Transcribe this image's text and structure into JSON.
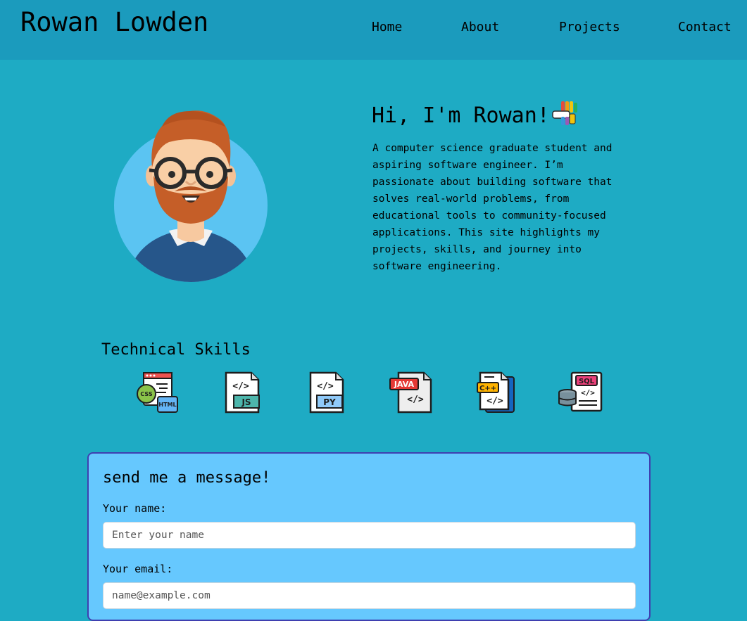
{
  "header": {
    "title": "Rowan Lowden",
    "nav": {
      "home": "Home",
      "about": "About",
      "projects": "Projects",
      "contact": "Contact"
    }
  },
  "hero": {
    "heading": "Hi, I'm Rowan!",
    "heading_icon": "waving-hand-icon",
    "bio": "A computer science graduate student and aspiring software engineer. I’m passionate about building software that solves real-world problems, from educational tools to community-focused applications. This site highlights my projects, skills, and journey into software engineering.",
    "avatar_icon": "avatar-illustration"
  },
  "skills": {
    "heading": "Technical Skills",
    "items": [
      {
        "icon": "css-html-icon",
        "labels": [
          "CSS",
          "HTML"
        ]
      },
      {
        "icon": "js-file-icon",
        "labels": [
          "JS"
        ]
      },
      {
        "icon": "python-file-icon",
        "labels": [
          "PY"
        ]
      },
      {
        "icon": "java-file-icon",
        "labels": [
          "JAVA"
        ]
      },
      {
        "icon": "cpp-file-icon",
        "labels": [
          "C++"
        ]
      },
      {
        "icon": "sql-database-icon",
        "labels": [
          "SQL"
        ]
      }
    ]
  },
  "contact_form": {
    "title": "send me a message!",
    "name_label": "Your name:",
    "name_placeholder": "Enter your name",
    "email_label": "Your email:",
    "email_placeholder": "name@example.com"
  },
  "colors": {
    "page_bg": "#1eabc4",
    "header_bg": "#1b9bbd",
    "form_bg": "#66c8fe",
    "form_border": "#3f3fb0"
  }
}
